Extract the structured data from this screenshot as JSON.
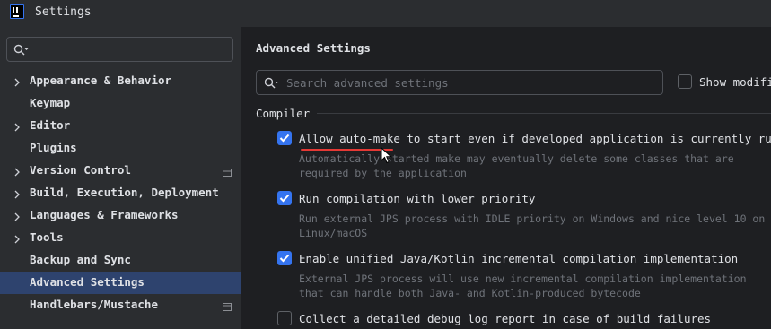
{
  "window": {
    "title": "Settings",
    "logo_icon": "jetbrains-logo-icon"
  },
  "sidebar": {
    "search": {
      "value": "",
      "icon": "search-icon"
    },
    "items": [
      {
        "label": "Appearance & Behavior",
        "expandable": true,
        "doc_icon": false,
        "selected": false
      },
      {
        "label": "Keymap",
        "expandable": false,
        "doc_icon": false,
        "selected": false
      },
      {
        "label": "Editor",
        "expandable": true,
        "doc_icon": false,
        "selected": false
      },
      {
        "label": "Plugins",
        "expandable": false,
        "doc_icon": false,
        "selected": false
      },
      {
        "label": "Version Control",
        "expandable": true,
        "doc_icon": true,
        "selected": false
      },
      {
        "label": "Build, Execution, Deployment",
        "expandable": true,
        "doc_icon": false,
        "selected": false
      },
      {
        "label": "Languages & Frameworks",
        "expandable": true,
        "doc_icon": false,
        "selected": false
      },
      {
        "label": "Tools",
        "expandable": true,
        "doc_icon": false,
        "selected": false
      },
      {
        "label": "Backup and Sync",
        "expandable": false,
        "doc_icon": false,
        "selected": false
      },
      {
        "label": "Advanced Settings",
        "expandable": false,
        "doc_icon": false,
        "selected": true
      },
      {
        "label": "Handlebars/Mustache",
        "expandable": false,
        "doc_icon": true,
        "selected": false
      }
    ]
  },
  "main": {
    "title": "Advanced Settings",
    "search": {
      "placeholder": "Search advanced settings",
      "value": ""
    },
    "show_modified": {
      "label": "Show modified",
      "checked": false
    },
    "group": "Compiler",
    "options": [
      {
        "label": "Allow auto-make to start even if developed application is currently running",
        "checked": true,
        "description": "Automatically started make may eventually delete some classes that are required by the application"
      },
      {
        "label": "Run compilation with lower priority",
        "checked": true,
        "description": "Run external JPS process with IDLE priority on Windows and nice level 10 on Linux/macOS"
      },
      {
        "label": "Enable unified Java/Kotlin incremental compilation implementation",
        "checked": true,
        "description": "External JPS process will use new incremental compilation implementation that can handle both Java- and Kotlin-produced bytecode"
      },
      {
        "label": "Collect a detailed debug log report in case of build failures",
        "checked": false,
        "description": ""
      }
    ]
  },
  "colors": {
    "selected_bg": "#2e436e",
    "checkbox_on": "#3574f0",
    "annotation": "#e53935"
  }
}
